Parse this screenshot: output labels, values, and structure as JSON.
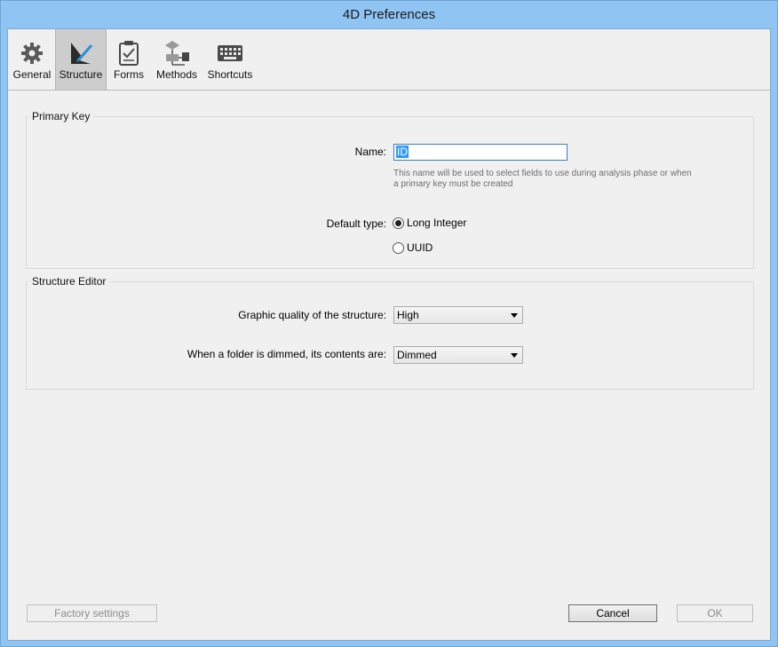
{
  "window": {
    "title": "4D Preferences"
  },
  "toolbar": {
    "items": [
      {
        "label": "General",
        "icon": "gear-icon"
      },
      {
        "label": "Structure",
        "icon": "structure-icon",
        "selected": true
      },
      {
        "label": "Forms",
        "icon": "clipboard-icon"
      },
      {
        "label": "Methods",
        "icon": "flowchart-icon"
      },
      {
        "label": "Shortcuts",
        "icon": "keyboard-icon"
      }
    ]
  },
  "primary_key": {
    "legend": "Primary Key",
    "name_label": "Name:",
    "name_value": "ID",
    "hint": "This name will be used to select fields to use during analysis phase or when a primary key must be created",
    "default_type_label": "Default type:",
    "options": [
      {
        "label": "Long Integer",
        "selected": true
      },
      {
        "label": "UUID",
        "selected": false
      }
    ]
  },
  "structure_editor": {
    "legend": "Structure Editor",
    "quality_label": "Graphic quality of the structure:",
    "quality_value": "High",
    "dimmed_label": "When a folder is dimmed, its contents are:",
    "dimmed_value": "Dimmed"
  },
  "buttons": {
    "factory": "Factory settings",
    "cancel": "Cancel",
    "ok": "OK"
  },
  "colors": {
    "title_bar": "#8fc4f3",
    "selection": "#3399ff",
    "panel": "#f0f0f0"
  }
}
